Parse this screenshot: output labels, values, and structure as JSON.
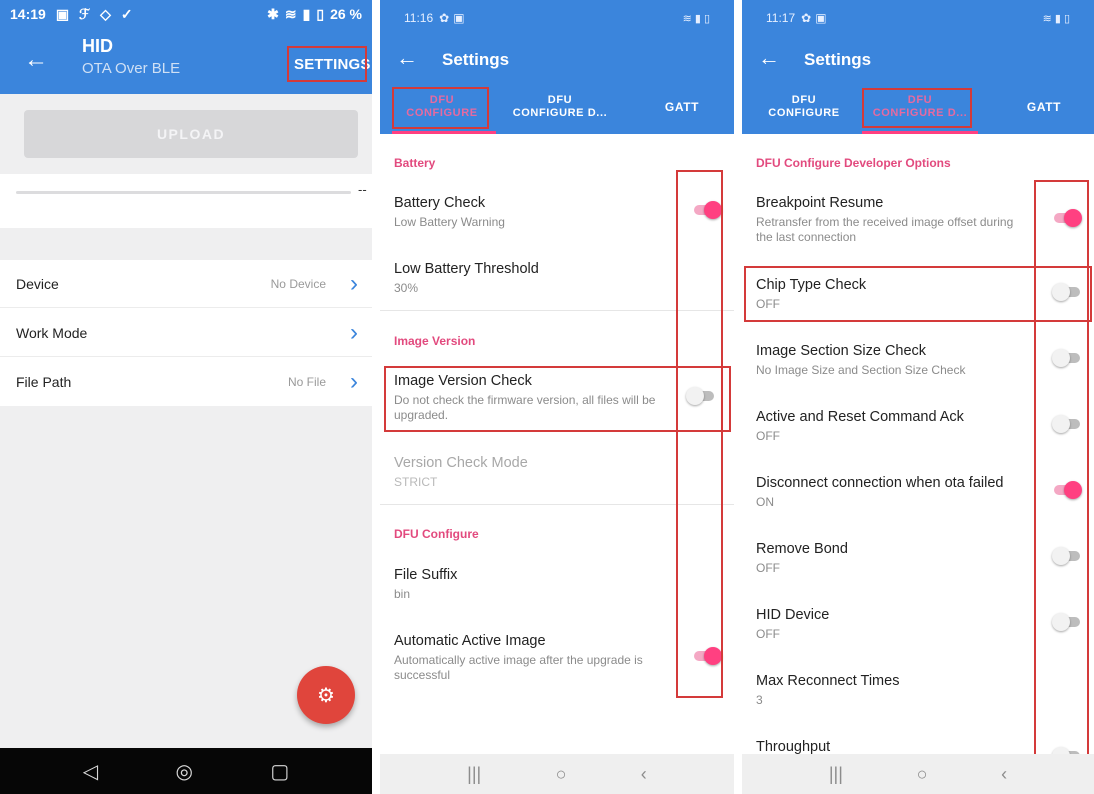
{
  "colors": {
    "app_bar": "#3b85dc",
    "accent_pink": "#ff4081",
    "highlight_red": "#d43a3a",
    "fab_red": "#e0453c"
  },
  "phone1": {
    "status": {
      "time": "14:19",
      "right": "26 %"
    },
    "toolbar": {
      "title": "HID",
      "subtitle": "OTA Over BLE",
      "settings_label": "SETTINGS",
      "back_icon": "back-arrow-icon"
    },
    "upload_label": "UPLOAD",
    "progress": {
      "value_text": "--",
      "fraction": 0
    },
    "rows": [
      {
        "label": "Device",
        "value": "No Device"
      },
      {
        "label": "Work Mode",
        "value": ""
      },
      {
        "label": "File Path",
        "value": "No File"
      }
    ],
    "fab_icon": "gear-icon",
    "nav": [
      "back-triangle-icon",
      "home-circle-icon",
      "recents-square-icon"
    ]
  },
  "phone2": {
    "status": {
      "time": "11:16"
    },
    "toolbar": {
      "title": "Settings"
    },
    "tabs": [
      {
        "line1": "DFU",
        "line2": "CONFIGURE",
        "active": true
      },
      {
        "line1": "DFU",
        "line2": "CONFIGURE D...",
        "active": false
      },
      {
        "line1": "GATT",
        "line2": "",
        "active": false
      }
    ],
    "sections": {
      "battery": "Battery",
      "image_version": "Image Version",
      "dfu_configure": "DFU Configure"
    },
    "items": {
      "battery_check": {
        "title": "Battery Check",
        "summary": "Low Battery Warning",
        "on": true
      },
      "low_battery_threshold": {
        "title": "Low Battery Threshold",
        "summary": "30%"
      },
      "image_version_check": {
        "title": "Image Version Check",
        "summary": "Do not check the firmware version, all files will be upgraded.",
        "on": false
      },
      "version_check_mode": {
        "title": "Version Check Mode",
        "summary": "STRICT"
      },
      "file_suffix": {
        "title": "File Suffix",
        "summary": "bin"
      },
      "automatic_active_image": {
        "title": "Automatic Active Image",
        "summary": "Automatically active image after the upgrade is successful",
        "on": true
      }
    }
  },
  "phone3": {
    "status": {
      "time": "11:17"
    },
    "toolbar": {
      "title": "Settings"
    },
    "tabs": [
      {
        "line1": "DFU",
        "line2": "CONFIGURE",
        "active": false
      },
      {
        "line1": "DFU",
        "line2": "CONFIGURE D...",
        "active": true
      },
      {
        "line1": "GATT",
        "line2": "",
        "active": false
      }
    ],
    "section": "DFU Configure Developer Options",
    "items": [
      {
        "title": "Breakpoint Resume",
        "summary": "Retransfer from the received image offset during the last connection",
        "on": true
      },
      {
        "title": "Chip Type Check",
        "summary": "OFF",
        "on": false
      },
      {
        "title": "Image Section Size Check",
        "summary": "No Image Size and Section Size Check",
        "on": false
      },
      {
        "title": "Active and Reset Command Ack",
        "summary": "OFF",
        "on": false
      },
      {
        "title": "Disconnect connection when ota failed",
        "summary": "ON",
        "on": true
      },
      {
        "title": "Remove Bond",
        "summary": "OFF",
        "on": false
      },
      {
        "title": "HID Device",
        "summary": "OFF",
        "on": false
      },
      {
        "title": "Max Reconnect Times",
        "summary": "3"
      },
      {
        "title": "Throughput",
        "summary": "",
        "on": false
      }
    ]
  }
}
